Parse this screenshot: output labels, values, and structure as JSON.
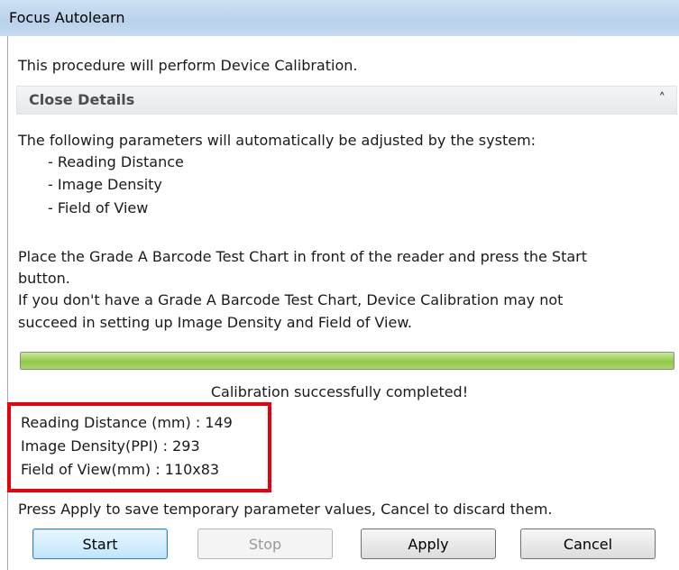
{
  "window": {
    "title": "Focus Autolearn"
  },
  "intro": "This procedure will perform Device Calibration.",
  "details": {
    "label": "Close Details",
    "icon": "chevron-up-icon"
  },
  "params": {
    "heading": "The following parameters will automatically be adjusted by the system:",
    "items": [
      "- Reading Distance",
      "- Image Density",
      "- Field of View"
    ]
  },
  "instructions": {
    "line1": "Place the Grade A Barcode Test Chart in front of the reader and press the Start",
    "line2": "button.",
    "line3": "If you don't have a Grade A Barcode Test Chart, Device Calibration may not",
    "line4": "succeed in setting up Image Density and Field of View."
  },
  "progress": {
    "percent": 100,
    "color": "#92c84a"
  },
  "status": "Calibration successfully completed!",
  "results": {
    "highlight_color": "#e8000c",
    "reading_distance": "Reading Distance (mm) :  149",
    "image_density": "Image Density(PPI) :  293",
    "field_of_view": "Field of View(mm) :  110x83"
  },
  "footer_note": "Press Apply to save temporary parameter values, Cancel to discard them.",
  "buttons": {
    "start": "Start",
    "stop": "Stop",
    "apply": "Apply",
    "cancel": "Cancel"
  }
}
